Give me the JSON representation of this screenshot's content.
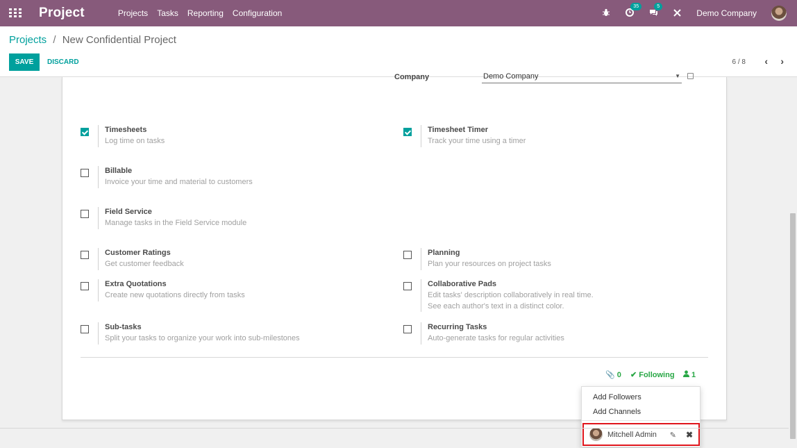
{
  "navbar": {
    "app_title": "Project",
    "menu": [
      "Projects",
      "Tasks",
      "Reporting",
      "Configuration"
    ],
    "activity_badge": "35",
    "messages_badge": "5",
    "company": "Demo Company",
    "icons": [
      "apps-grid-icon",
      "bug-icon",
      "clock-icon",
      "chat-icon",
      "close-icon",
      "user-avatar"
    ]
  },
  "breadcrumb": {
    "parent": "Projects",
    "separator": "/",
    "current": "New Confidential Project"
  },
  "buttons": {
    "save": "SAVE",
    "discard": "DISCARD"
  },
  "pager": {
    "value": "6 / 8",
    "prev": "‹",
    "next": "›"
  },
  "form": {
    "company_label": "Company",
    "company_value": "Demo Company"
  },
  "settings": [
    {
      "title": "Timesheets",
      "desc": "Log time on tasks",
      "checked": true
    },
    {
      "title": "Timesheet Timer",
      "desc": "Track your time using a timer",
      "checked": true
    },
    {
      "title": "Billable",
      "desc": "Invoice your time and material to customers",
      "checked": false
    },
    {
      "title": "Field Service",
      "desc": "Manage tasks in the Field Service module",
      "checked": false
    },
    {
      "title": "Customer Ratings",
      "desc": "Get customer feedback",
      "checked": false
    },
    {
      "title": "Planning",
      "desc": "Plan your resources on project tasks",
      "checked": false
    },
    {
      "title": "Extra Quotations",
      "desc": "Create new quotations directly from tasks",
      "checked": false
    },
    {
      "title": "Collaborative Pads",
      "desc": "Edit tasks' description collaboratively in real time.",
      "desc2": "See each author's text in a distinct color.",
      "checked": false
    },
    {
      "title": "Sub-tasks",
      "desc": "Split your tasks to organize your work into sub-milestones",
      "checked": false
    },
    {
      "title": "Recurring Tasks",
      "desc": "Auto-generate tasks for regular activities",
      "checked": false
    }
  ],
  "chatter": {
    "attachments": "0",
    "following": "Following",
    "followers": "1"
  },
  "followers_dropdown": {
    "add_followers": "Add Followers",
    "add_channels": "Add Channels",
    "follower_name": "Mitchell Admin"
  },
  "colors": {
    "navbar": "#875a7b",
    "primary": "#00a09d",
    "following": "#28a745",
    "highlight": "#e0151c"
  }
}
